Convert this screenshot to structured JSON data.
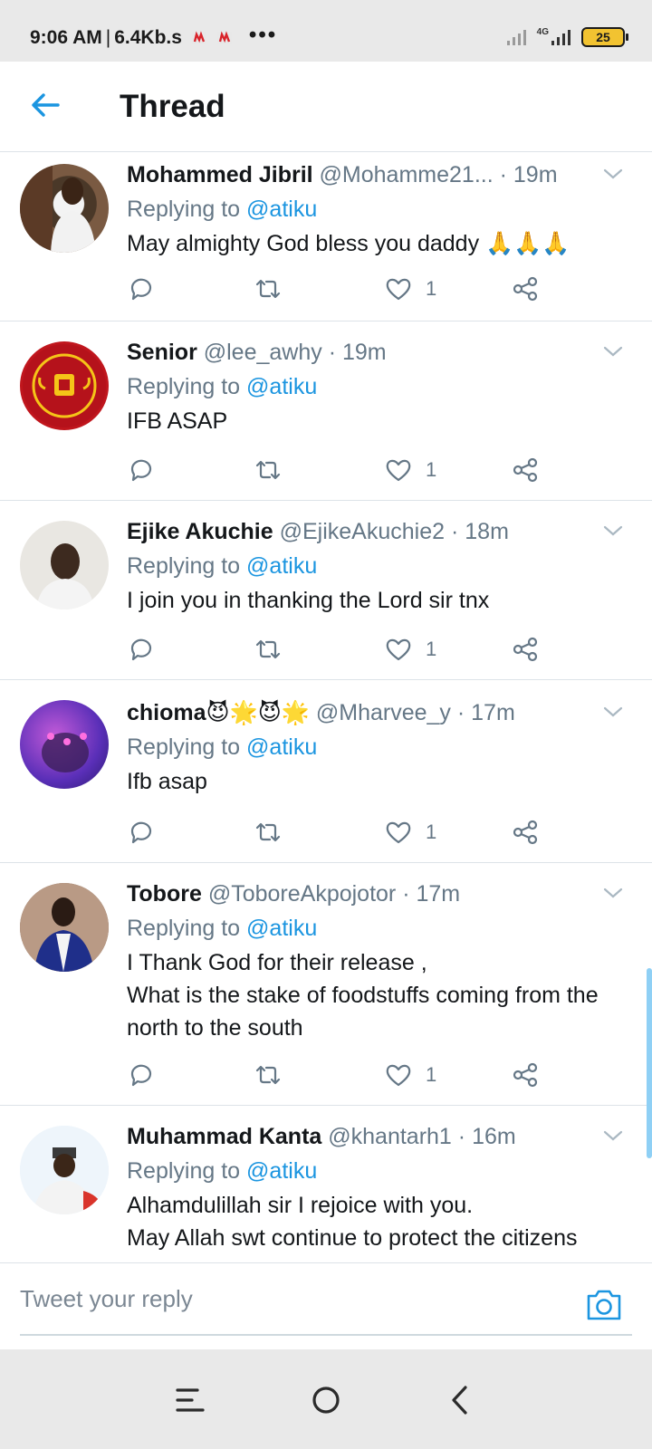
{
  "status_bar": {
    "time": "9:06 AM",
    "separator": "|",
    "speed": "6.4Kb.s",
    "more_dots": "•••",
    "network": "4G",
    "battery": "25"
  },
  "header": {
    "title": "Thread",
    "back_icon": "arrow-left-icon"
  },
  "tweets": [
    {
      "name": "Mohammed Jibril",
      "handle": "@Mohamme21...",
      "time": "19m",
      "replying_prefix": "Replying to",
      "replying_to": "@atiku",
      "text": "May almighty God bless you daddy 🙏🙏🙏",
      "likes": "1"
    },
    {
      "name": "Senior",
      "handle": "@lee_awhy",
      "time": "19m",
      "replying_prefix": "Replying to",
      "replying_to": "@atiku",
      "text": "IFB ASAP",
      "likes": "1"
    },
    {
      "name": "Ejike Akuchie",
      "handle": "@EjikeAkuchie2",
      "time": "18m",
      "replying_prefix": "Replying to",
      "replying_to": "@atiku",
      "text": "I join you in thanking the Lord sir tnx",
      "likes": "1"
    },
    {
      "name": "chioma😈🌟😈🌟",
      "handle": "@Mharvee_y",
      "time": "17m",
      "replying_prefix": "Replying to",
      "replying_to": "@atiku",
      "text": "Ifb asap",
      "likes": "1"
    },
    {
      "name": "Tobore",
      "handle": "@ToboreAkpojotor",
      "time": "17m",
      "replying_prefix": "Replying to",
      "replying_to": "@atiku",
      "text": "I Thank God for their release ,\nWhat is the stake  of foodstuffs coming from the north to the south",
      "likes": "1"
    },
    {
      "name": "Muhammad Kanta",
      "handle": "@khantarh1",
      "time": "16m",
      "replying_prefix": "Replying to",
      "replying_to": "@atiku",
      "text": "Alhamdulillah sir I rejoice with you.\nMay Allah swt continue to protect the citizens",
      "likes": ""
    }
  ],
  "reply_bar": {
    "placeholder": "Tweet your reply",
    "camera_icon": "camera-icon"
  },
  "colors": {
    "accent": "#1b95e0",
    "secondary_text": "#657786",
    "divider": "#dde3e8"
  }
}
